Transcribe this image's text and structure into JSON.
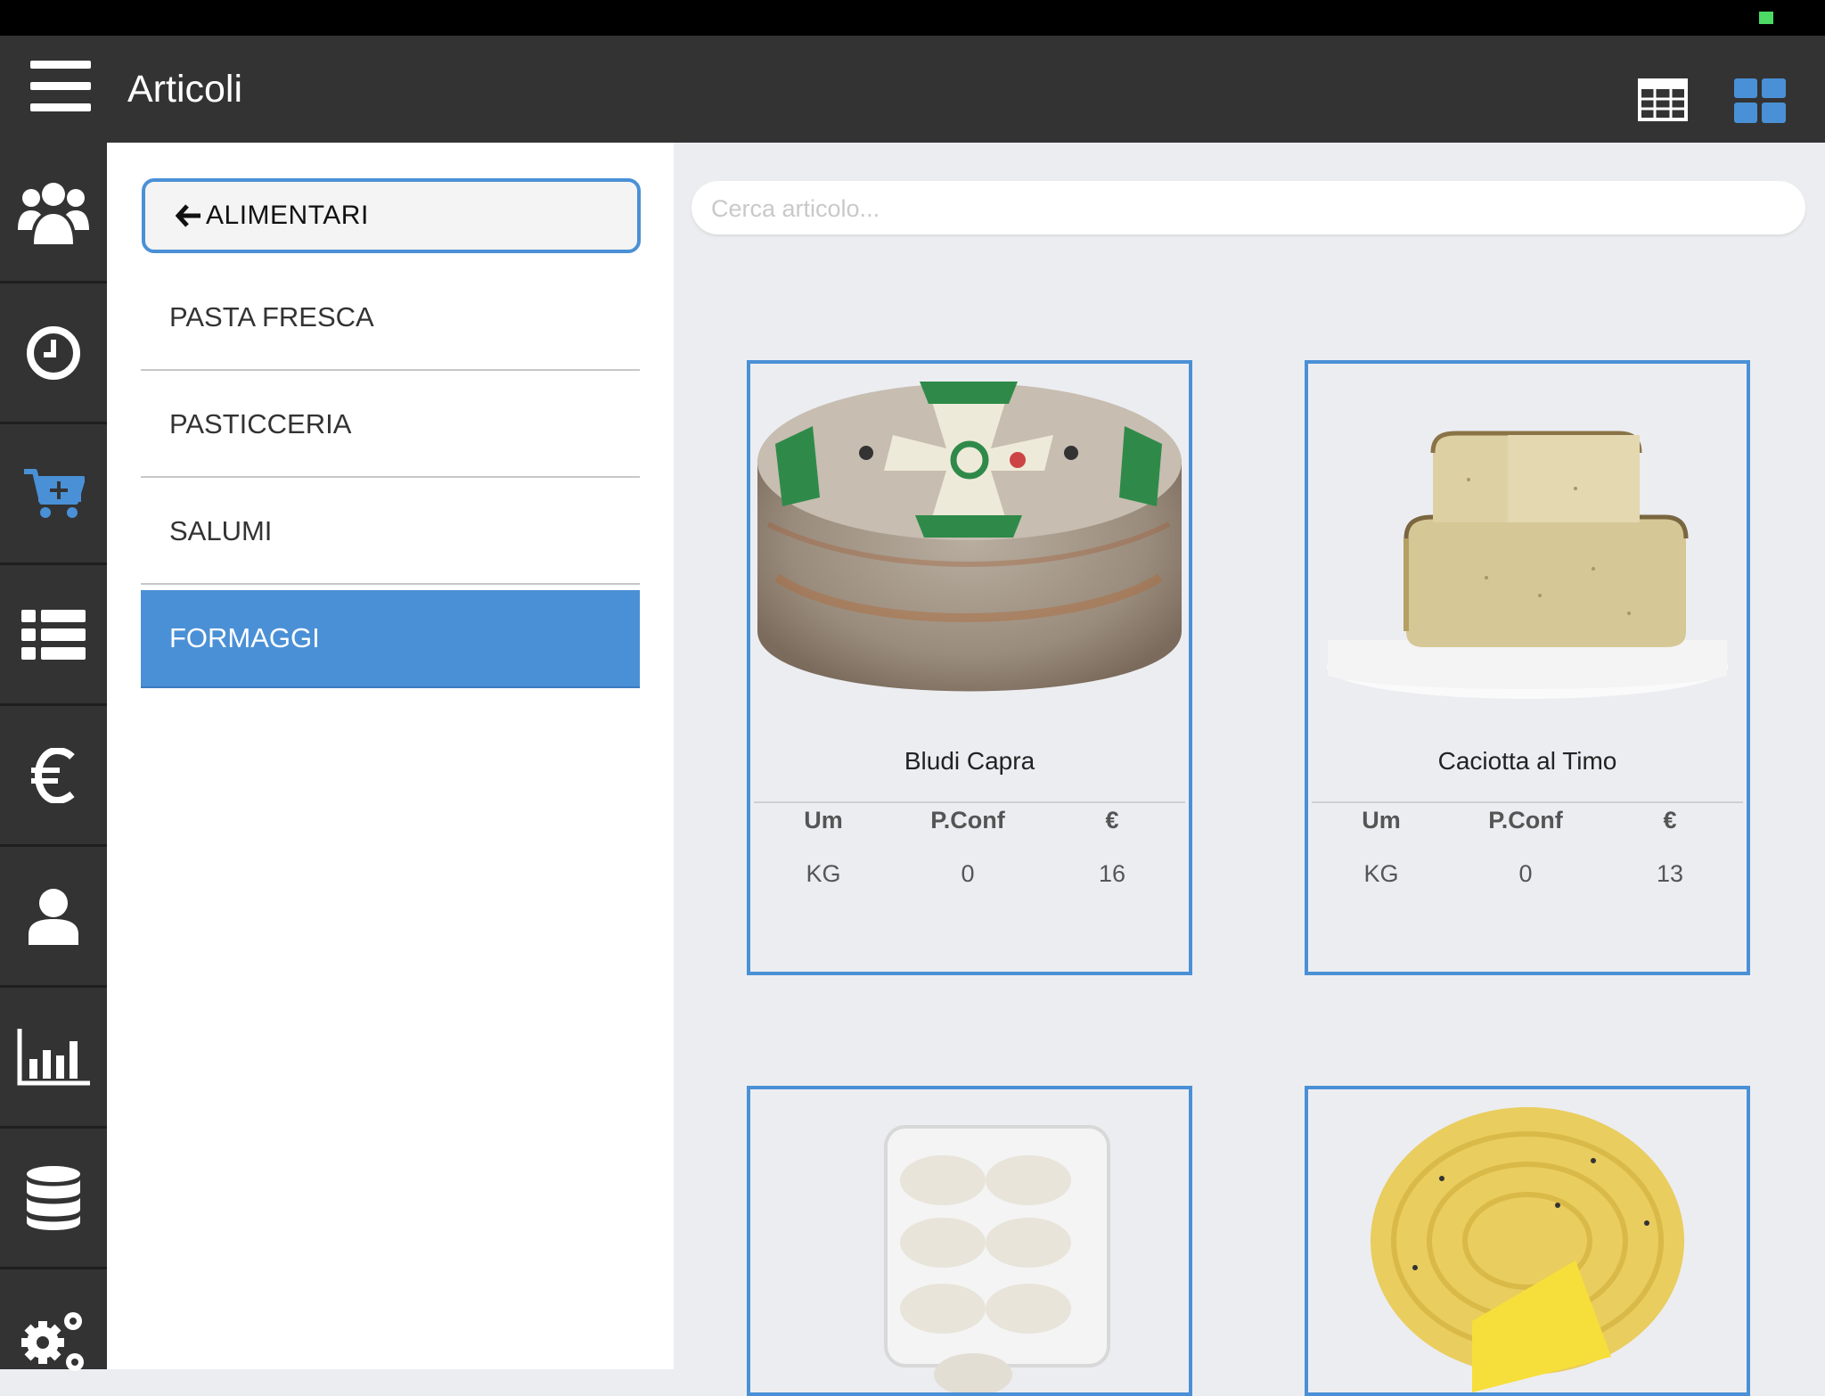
{
  "header": {
    "title": "Articoli",
    "menu_icon": "hamburger-icon",
    "view_icons": [
      "table-grid-icon",
      "tiles-icon"
    ],
    "accent_color": "#4a90d6"
  },
  "sidebar": {
    "items": [
      {
        "icon": "users-icon"
      },
      {
        "icon": "clock-icon"
      },
      {
        "icon": "cart-add-icon",
        "active": true
      },
      {
        "icon": "list-icon"
      },
      {
        "icon": "euro-icon"
      },
      {
        "icon": "user-icon"
      },
      {
        "icon": "bar-chart-icon"
      },
      {
        "icon": "database-icon"
      },
      {
        "icon": "gears-icon"
      }
    ]
  },
  "categories": {
    "back_label": "ALIMENTARI",
    "items": [
      {
        "label": "PASTA FRESCA",
        "active": false
      },
      {
        "label": "PASTICCERIA",
        "active": false
      },
      {
        "label": "SALUMI",
        "active": false
      },
      {
        "label": "FORMAGGI",
        "active": true
      }
    ]
  },
  "search": {
    "placeholder": "Cerca articolo..."
  },
  "products": [
    {
      "name": "Bludi Capra",
      "headers": [
        "Um",
        "P.Conf",
        "€"
      ],
      "values": [
        "KG",
        "0",
        "16"
      ]
    },
    {
      "name": "Caciotta al Timo",
      "headers": [
        "Um",
        "P.Conf",
        "€"
      ],
      "values": [
        "KG",
        "0",
        "13"
      ]
    },
    {
      "name": "",
      "headers": [],
      "values": []
    },
    {
      "name": "",
      "headers": [],
      "values": []
    }
  ]
}
